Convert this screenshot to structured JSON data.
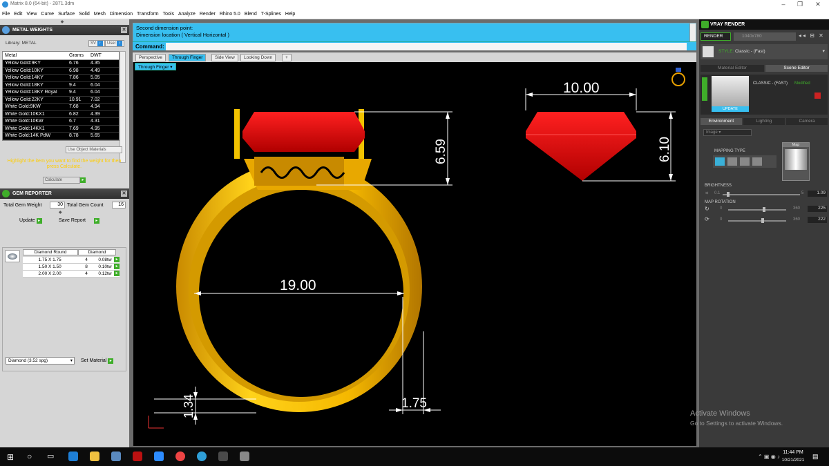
{
  "window": {
    "title": "Matrix 8.0 (64-bit) - 2871.3dm"
  },
  "menu": [
    "File",
    "Edit",
    "View",
    "Curve",
    "Surface",
    "Solid",
    "Mesh",
    "Dimension",
    "Transform",
    "Tools",
    "Analyze",
    "Render",
    "Rhino 5.0",
    "Blend",
    "T-Splines",
    "Help"
  ],
  "metal_weights": {
    "title": "METAL WEIGHTS",
    "library_label": "Library: METAL",
    "btn_sv": "SV",
    "btn_user": "User",
    "columns": [
      "Metal",
      "Grams",
      "DWT"
    ],
    "rows": [
      [
        "Yellow Gold:9KY",
        "6.76",
        "4.35"
      ],
      [
        "Yellow Gold:10KY",
        "6.98",
        "4.49"
      ],
      [
        "Yellow Gold:14KY",
        "7.86",
        "5.05"
      ],
      [
        "Yellow Gold:18KY",
        "9.4",
        "6.04"
      ],
      [
        "Yellow Gold:18KY Royal",
        "9.4",
        "6.04"
      ],
      [
        "Yellow Gold:22KY",
        "10.91",
        "7.02"
      ],
      [
        "White Gold:9KW",
        "7.68",
        "4.94"
      ],
      [
        "White Gold:10KX1",
        "6.82",
        "4.39"
      ],
      [
        "White Gold:10KW",
        "6.7",
        "4.31"
      ],
      [
        "White Gold:14KX1",
        "7.69",
        "4.95"
      ],
      [
        "White Gold:14K PdW",
        "8.78",
        "5.65"
      ]
    ],
    "use_object_materials": "Use Object Materials",
    "hint": "Highlight the item you want to find the weight for then press Calculate.",
    "calculate": "Calculate"
  },
  "gem_reporter": {
    "title": "GEM REPORTER",
    "total_weight_label": "Total Gem Weight",
    "total_weight": "30",
    "total_count_label": "Total Gem Count",
    "total_count": "16",
    "update": "Update",
    "save_report": "Save Report",
    "col1": "Diamond Round",
    "col2": "Diamond",
    "rows": [
      [
        "1.75 X 1.75",
        "4",
        "0.08tw"
      ],
      [
        "1.50 X 1.50",
        "8",
        "0.10tw"
      ],
      [
        "2.00 X 2.00",
        "4",
        "0.12tw"
      ]
    ],
    "material_select": "Diamond    (3.52 spg)",
    "set_material": "Set Material"
  },
  "command": {
    "line1": "Second dimension point:",
    "line2": "Dimension location ( Vertical  Horizontal )",
    "label": "Command:"
  },
  "tabs": [
    "Perspective",
    "Through Finger",
    "Side View",
    "Looking Down"
  ],
  "view_label": "Through Finger",
  "dimensions": {
    "top_width": "10.00",
    "left_height": "6.59",
    "right_height": "6.10",
    "inner": "19.00",
    "bottom_left": "1.34",
    "bottom_right": "1.75"
  },
  "vray": {
    "title": "VRAY RENDER",
    "render": "RENDER",
    "resolution": "1040x780",
    "style_label": "STYLE:",
    "style_value": "Classic - (Fast)",
    "tab_material": "Material Editor",
    "tab_scene": "Scene Editor",
    "preset": "CLASSIC - (FAST)",
    "modified": "Modified",
    "update": "UPDATE",
    "tabs2": [
      "Environment",
      "Lighting",
      "Camera"
    ],
    "image_select": "Image",
    "mapping_type": "MAPPING TYPE",
    "map": "Map",
    "brightness": "BRIGHTNESS",
    "brightness_min": "0.1",
    "brightness_max": "5",
    "brightness_val": "1.09",
    "map_rotation": "MAP ROTATION",
    "rot_min": "0",
    "rot_max": "360",
    "rot1": "225",
    "rot2": "222"
  },
  "watermark": {
    "l1": "Activate Windows",
    "l2": "Go to Settings to activate Windows."
  },
  "taskbar": {
    "time": "11:44 PM",
    "date": "10/21/2021"
  },
  "colors": {
    "cyan": "#38bff0",
    "gold": "#f2b400",
    "red": "#e00000"
  }
}
